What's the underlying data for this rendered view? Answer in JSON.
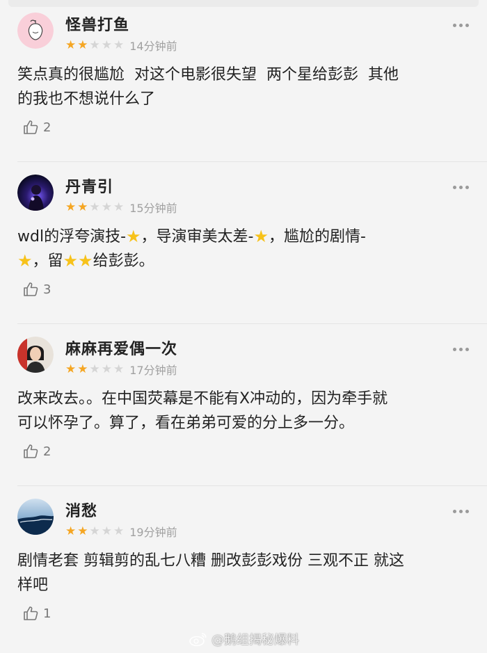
{
  "comments": [
    {
      "username": "怪兽打鱼",
      "rating": 2,
      "time": "14分钟前",
      "text": "笑点真的很尴尬  对这个电影很失望  两个星给彭彭  其他\n的我也不想说什么了",
      "likes": "2",
      "avatar_icon": "peach-avatar-icon"
    },
    {
      "username": "丹青引",
      "rating": 2,
      "time": "15分钟前",
      "text_parts": [
        "wdl的浮夸演技-",
        "，导演审美太差-",
        "，尴尬的剧情-",
        "，留",
        "给彭彭。"
      ],
      "likes": "3",
      "avatar_icon": "stage-photo-avatar-icon"
    },
    {
      "username": "麻麻再爱偶一次",
      "rating": 2,
      "time": "17分钟前",
      "text": "改来改去。。在中国荧幕是不能有X冲动的，因为牵手就\n可以怀孕了。算了，看在弟弟可爱的分上多一分。",
      "likes": "2",
      "avatar_icon": "woman-portrait-avatar-icon"
    },
    {
      "username": "消愁",
      "rating": 2,
      "time": "19分钟前",
      "text": "剧情老套 剪辑剪的乱七八糟 删改彭彭戏份 三观不正 就这\n样吧",
      "likes": "1",
      "avatar_icon": "sea-landscape-avatar-icon"
    }
  ],
  "watermark": "@鹅组揭秘爆料",
  "colors": {
    "star_on": "#f5a623",
    "star_off": "#d5d5d5",
    "time": "#a0a0a0",
    "background": "#f4f4f4"
  }
}
